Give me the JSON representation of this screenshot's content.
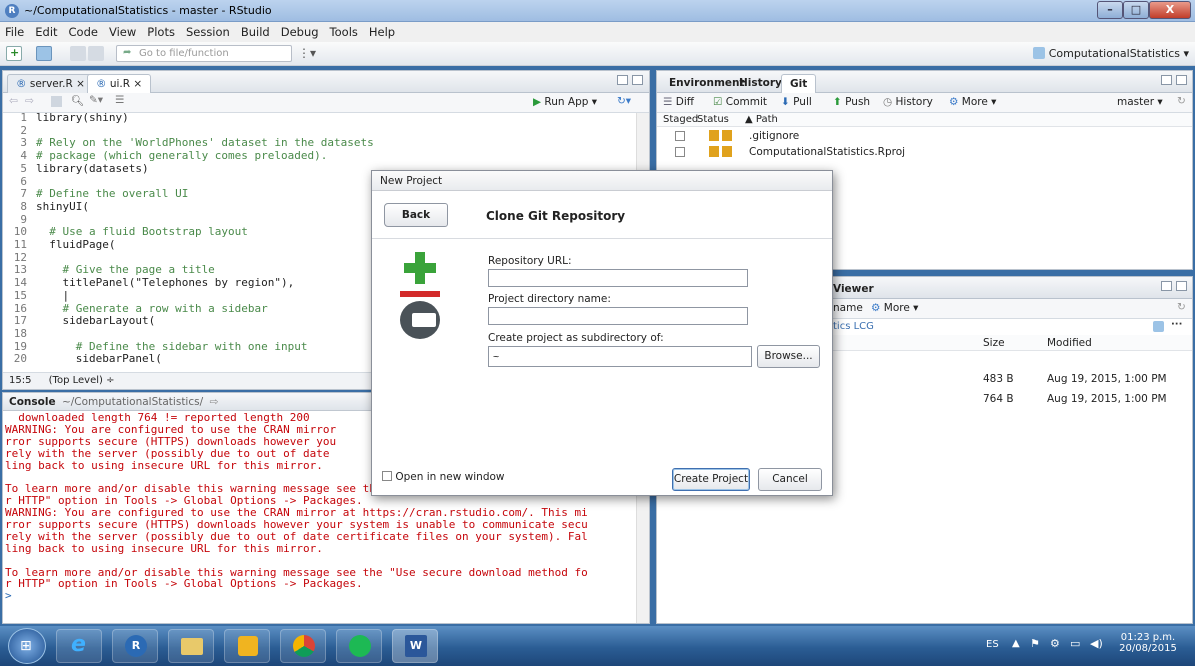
{
  "window": {
    "title": "~/ComputationalStatistics - master - RStudio",
    "minimize": "–",
    "maximize": "□",
    "close": "X"
  },
  "menu": [
    "File",
    "Edit",
    "Code",
    "View",
    "Plots",
    "Session",
    "Build",
    "Debug",
    "Tools",
    "Help"
  ],
  "toolbar": {
    "goto_placeholder": "Go to file/function",
    "project": "ComputationalStatistics ▾"
  },
  "editor": {
    "tabs": [
      "server.R ×",
      "ui.R ×"
    ],
    "run_app": "Run App",
    "lines": [
      {
        "n": "1",
        "t": "library(shiny)"
      },
      {
        "n": "2",
        "t": ""
      },
      {
        "n": "3",
        "t": "# Rely on the 'WorldPhones' dataset in the datasets",
        "c": true
      },
      {
        "n": "4",
        "t": "# package (which generally comes preloaded).",
        "c": true
      },
      {
        "n": "5",
        "t": "library(datasets)"
      },
      {
        "n": "6",
        "t": ""
      },
      {
        "n": "7",
        "t": "# Define the overall UI",
        "c": true
      },
      {
        "n": "8",
        "t": "shinyUI("
      },
      {
        "n": "9",
        "t": ""
      },
      {
        "n": "10",
        "t": "  # Use a fluid Bootstrap layout",
        "c": true
      },
      {
        "n": "11",
        "t": "  fluidPage("
      },
      {
        "n": "12",
        "t": ""
      },
      {
        "n": "13",
        "t": "    # Give the page a title",
        "c": true
      },
      {
        "n": "14",
        "t": "    titlePanel(\"Telephones by region\"),"
      },
      {
        "n": "15",
        "t": "    |"
      },
      {
        "n": "16",
        "t": "    # Generate a row with a sidebar",
        "c": true
      },
      {
        "n": "17",
        "t": "    sidebarLayout("
      },
      {
        "n": "18",
        "t": ""
      },
      {
        "n": "19",
        "t": "      # Define the sidebar with one input",
        "c": true
      },
      {
        "n": "20",
        "t": "      sidebarPanel("
      }
    ],
    "status_pos": "15:5",
    "status_scope": "(Top Level) ÷"
  },
  "console": {
    "title": "Console",
    "path": "~/ComputationalStatistics/",
    "lines": [
      "  downloaded length 764 != reported length 200",
      "WARNING: You are configured to use the CRAN mirror",
      "rror supports secure (HTTPS) downloads however you",
      "rely with the server (possibly due to out of date",
      "ling back to using insecure URL for this mirror.",
      "",
      "To learn more and/or disable this warning message see the \"Use secure download method fo",
      "r HTTP\" option in Tools -> Global Options -> Packages.",
      "WARNING: You are configured to use the CRAN mirror at https://cran.rstudio.com/. This mi",
      "rror supports secure (HTTPS) downloads however your system is unable to communicate secu",
      "rely with the server (possibly due to out of date certificate files on your system). Fal",
      "ling back to using insecure URL for this mirror.",
      "",
      "To learn more and/or disable this warning message see the \"Use secure download method fo",
      "r HTTP\" option in Tools -> Global Options -> Packages."
    ],
    "prompt": ">"
  },
  "env_pane": {
    "tabs": [
      "Environment",
      "History",
      "Git"
    ],
    "buttons": [
      "Diff",
      "Commit",
      "Pull",
      "Push",
      "History",
      "More ▾"
    ],
    "branch": "master ▾",
    "headers": [
      "Staged",
      "Status",
      "Path"
    ],
    "rows": [
      {
        "path": ".gitignore"
      },
      {
        "path": "ComputationalStatistics.Rproj"
      }
    ]
  },
  "files_pane": {
    "tab_viewer": "Viewer",
    "rename": "name",
    "more": "More ▾",
    "crumb": "tics  LCG",
    "headers": [
      "Size",
      "Modified"
    ],
    "rows": [
      {
        "size": "483 B",
        "modified": "Aug 19, 2015, 1:00 PM"
      },
      {
        "size": "764 B",
        "modified": "Aug 19, 2015, 1:00 PM"
      }
    ]
  },
  "dialog": {
    "title": "New Project",
    "back": "Back",
    "heading": "Clone Git Repository",
    "repo_label": "Repository URL:",
    "repo_value": "",
    "dir_label": "Project directory name:",
    "dir_value": "",
    "sub_label": "Create project as subdirectory of:",
    "sub_value": "~",
    "browse": "Browse...",
    "open_new": "Open in new window",
    "create": "Create Project",
    "cancel": "Cancel"
  },
  "taskbar": {
    "lang": "ES",
    "time": "01:23 p.m.",
    "date": "20/08/2015"
  }
}
